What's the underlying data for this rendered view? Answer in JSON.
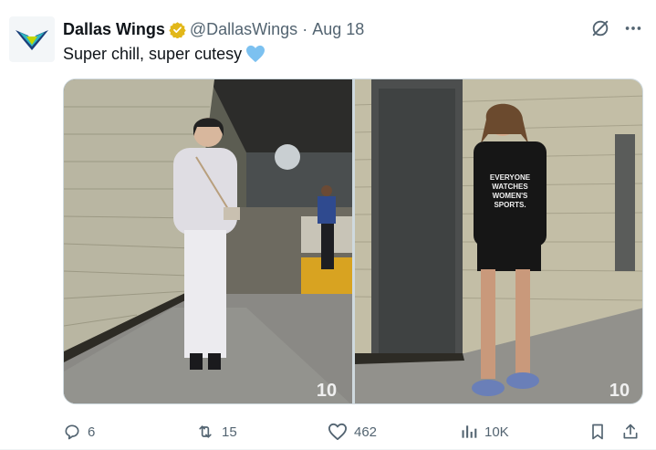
{
  "tweet": {
    "display_name": "Dallas Wings",
    "handle": "@DallasWings",
    "separator": "·",
    "date": "Aug 18",
    "text": "Super chill, super cutesy",
    "emoji": "💙"
  },
  "icons": {
    "avatar": "dallas-wings-logo",
    "verified": "verified-badge-icon",
    "grok": "grok-icon",
    "more": "more-icon",
    "reply": "reply-icon",
    "retweet": "retweet-icon",
    "like": "like-icon",
    "views": "views-icon",
    "bookmark": "bookmark-icon",
    "share": "share-icon"
  },
  "stats": {
    "replies": "6",
    "retweets": "15",
    "likes": "462",
    "views": "10K"
  },
  "colors": {
    "text": "#0f1419",
    "secondary": "#536471",
    "verified": "#e2b719",
    "heart": "#7cc1f0",
    "border": "#cfd9de"
  }
}
